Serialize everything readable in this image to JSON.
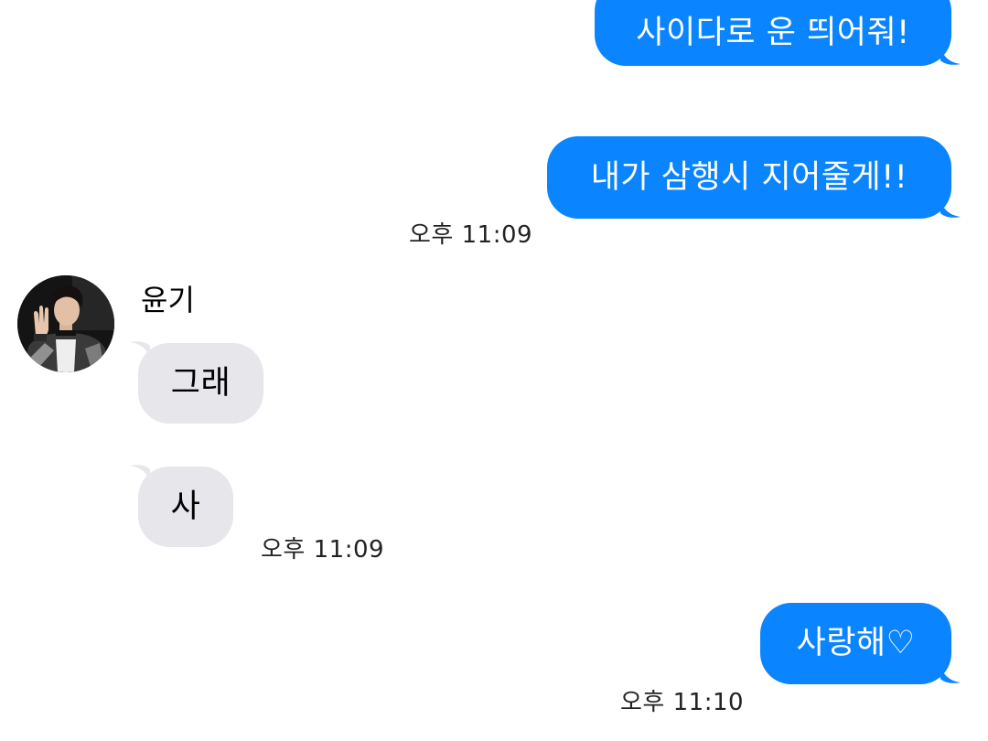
{
  "messages": [
    {
      "text": "사이다로 운 띄어줘!",
      "direction": "outgoing"
    },
    {
      "text": "내가 삼행시 지어줄게!!",
      "direction": "outgoing"
    },
    {
      "text": "그래",
      "direction": "incoming"
    },
    {
      "text": "사",
      "direction": "incoming"
    },
    {
      "text": "사랑해♡",
      "direction": "outgoing"
    }
  ],
  "timestamps": [
    "오후 11:09",
    "오후 11:09",
    "오후 11:10"
  ],
  "contact": {
    "name": "윤기",
    "avatar_icon": "contact-photo"
  },
  "colors": {
    "outgoing_bubble": "#0a84ff",
    "incoming_bubble": "#e6e6eb",
    "outgoing_text": "#ffffff",
    "incoming_text": "#000000"
  }
}
